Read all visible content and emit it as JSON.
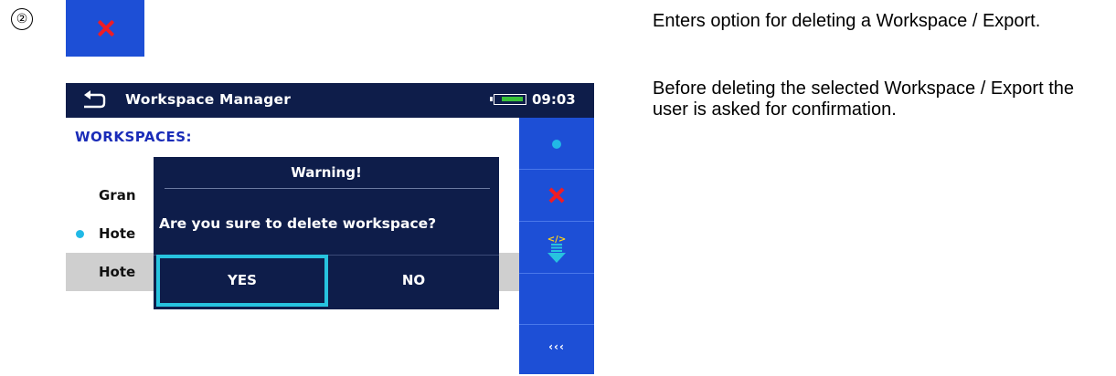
{
  "step": {
    "number": "②"
  },
  "delete_button": {
    "icon": "close-icon",
    "color": "#1d4fd6",
    "icon_color": "#ee1c25"
  },
  "description": {
    "line1": "Enters option for deleting a Workspace / Export.",
    "line2": "Before deleting the selected Workspace / Export the user is asked for confirmation."
  },
  "device": {
    "header": {
      "title": "Workspace Manager",
      "time": "09:03",
      "back_icon": "back-arrow-icon",
      "battery_icon": "battery-icon"
    },
    "section_label": "WORKSPACES:",
    "workspaces": [
      {
        "label": "Gran",
        "active": false
      },
      {
        "label": "Hote",
        "active": true
      },
      {
        "label": "Hote",
        "active": false,
        "selected": true
      }
    ],
    "sidebar": [
      {
        "icon": "dot-icon"
      },
      {
        "icon": "close-icon"
      },
      {
        "icon": "export-icon"
      },
      {
        "icon": "empty"
      },
      {
        "label": "‹‹‹"
      }
    ],
    "dialog": {
      "title": "Warning!",
      "message": "Are you sure to delete workspace?",
      "yes_label": "YES",
      "no_label": "NO"
    },
    "colors": {
      "header_bg": "#0e1d4a",
      "accent_blue": "#1a2cb8",
      "cyan": "#21b9e6",
      "sidebar_btn": "#1d4fd6",
      "selected_row": "#cfcfcf"
    }
  }
}
